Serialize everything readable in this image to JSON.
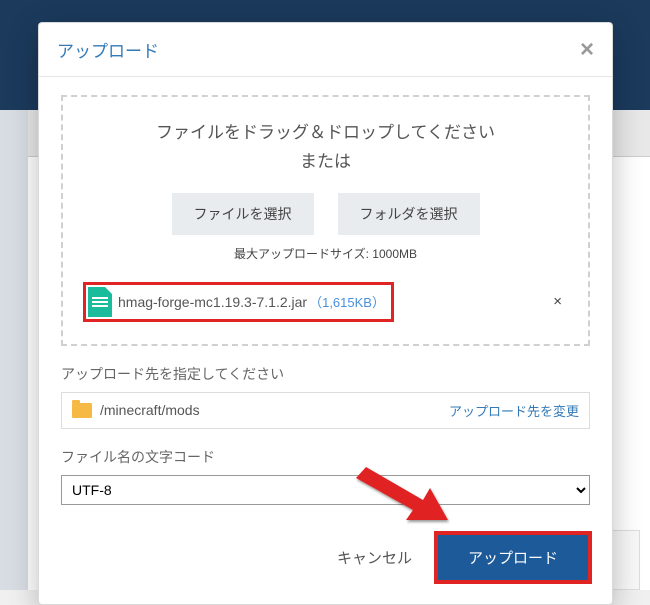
{
  "modal": {
    "title": "アップロード",
    "drop_instruction_line1": "ファイルをドラッグ＆ドロップしてください",
    "drop_instruction_line2": "または",
    "select_file_label": "ファイルを選択",
    "select_folder_label": "フォルダを選択",
    "max_size_label": "最大アップロードサイズ: 1000MB",
    "file": {
      "name": "hmag-forge-mc1.19.3-7.1.2.jar",
      "size": "（1,615KB）"
    },
    "destination_label": "アップロード先を指定してください",
    "destination_path": "/minecraft/mods",
    "change_destination_label": "アップロード先を変更",
    "encoding_label": "ファイル名の文字コード",
    "encoding_value": "UTF-8",
    "cancel_label": "キャンセル",
    "upload_label": "アップロード"
  }
}
